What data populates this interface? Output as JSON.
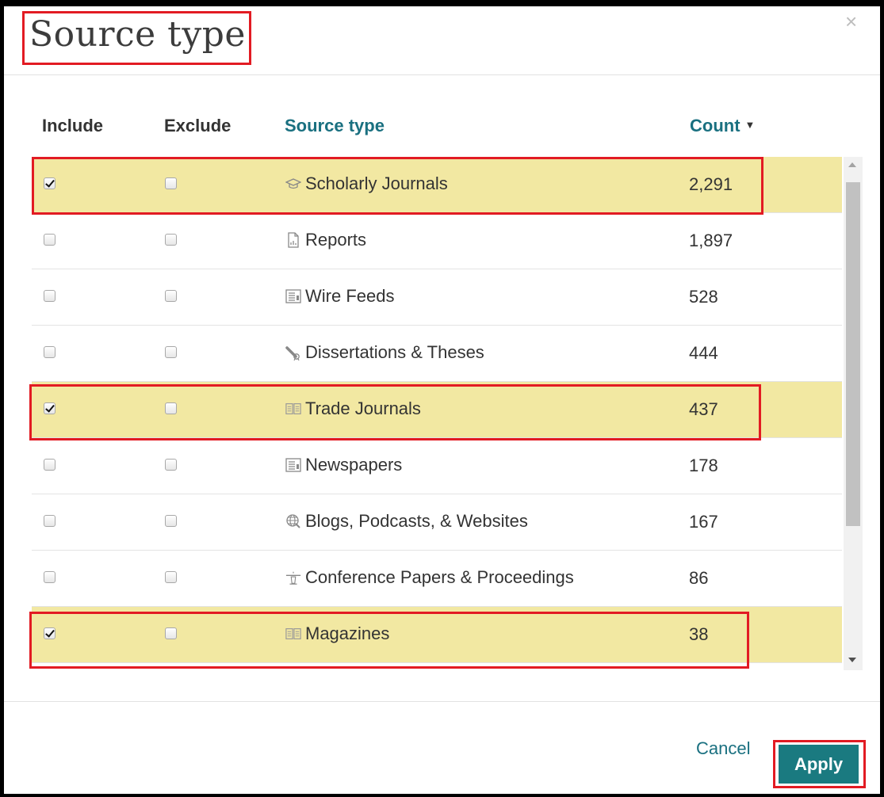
{
  "dialog": {
    "title": "Source type",
    "close_glyph": "×"
  },
  "columns": {
    "include": "Include",
    "exclude": "Exclude",
    "source_type": "Source type",
    "count": "Count",
    "sort_indicator": "▼"
  },
  "rows": [
    {
      "label": "Scholarly Journals",
      "count": "2,291",
      "icon": "graduation-cap-icon",
      "include": true,
      "exclude": false
    },
    {
      "label": "Reports",
      "count": "1,897",
      "icon": "report-document-icon",
      "include": false,
      "exclude": false
    },
    {
      "label": "Wire Feeds",
      "count": "528",
      "icon": "wire-feed-icon",
      "include": false,
      "exclude": false
    },
    {
      "label": "Dissertations & Theses",
      "count": "444",
      "icon": "diploma-icon",
      "include": false,
      "exclude": false
    },
    {
      "label": "Trade Journals",
      "count": "437",
      "icon": "open-book-icon",
      "include": true,
      "exclude": false
    },
    {
      "label": "Newspapers",
      "count": "178",
      "icon": "newspaper-icon",
      "include": false,
      "exclude": false
    },
    {
      "label": "Blogs, Podcasts, & Websites",
      "count": "167",
      "icon": "globe-icon",
      "include": false,
      "exclude": false
    },
    {
      "label": "Conference Papers & Proceedings",
      "count": "86",
      "icon": "podium-icon",
      "include": false,
      "exclude": false
    },
    {
      "label": "Magazines",
      "count": "38",
      "icon": "open-book-icon",
      "include": true,
      "exclude": false
    }
  ],
  "footer": {
    "cancel": "Cancel",
    "apply": "Apply"
  },
  "colors": {
    "accent": "#1a7a80",
    "selected_row": "#f2e8a2",
    "annotation_red": "#e21b23"
  }
}
